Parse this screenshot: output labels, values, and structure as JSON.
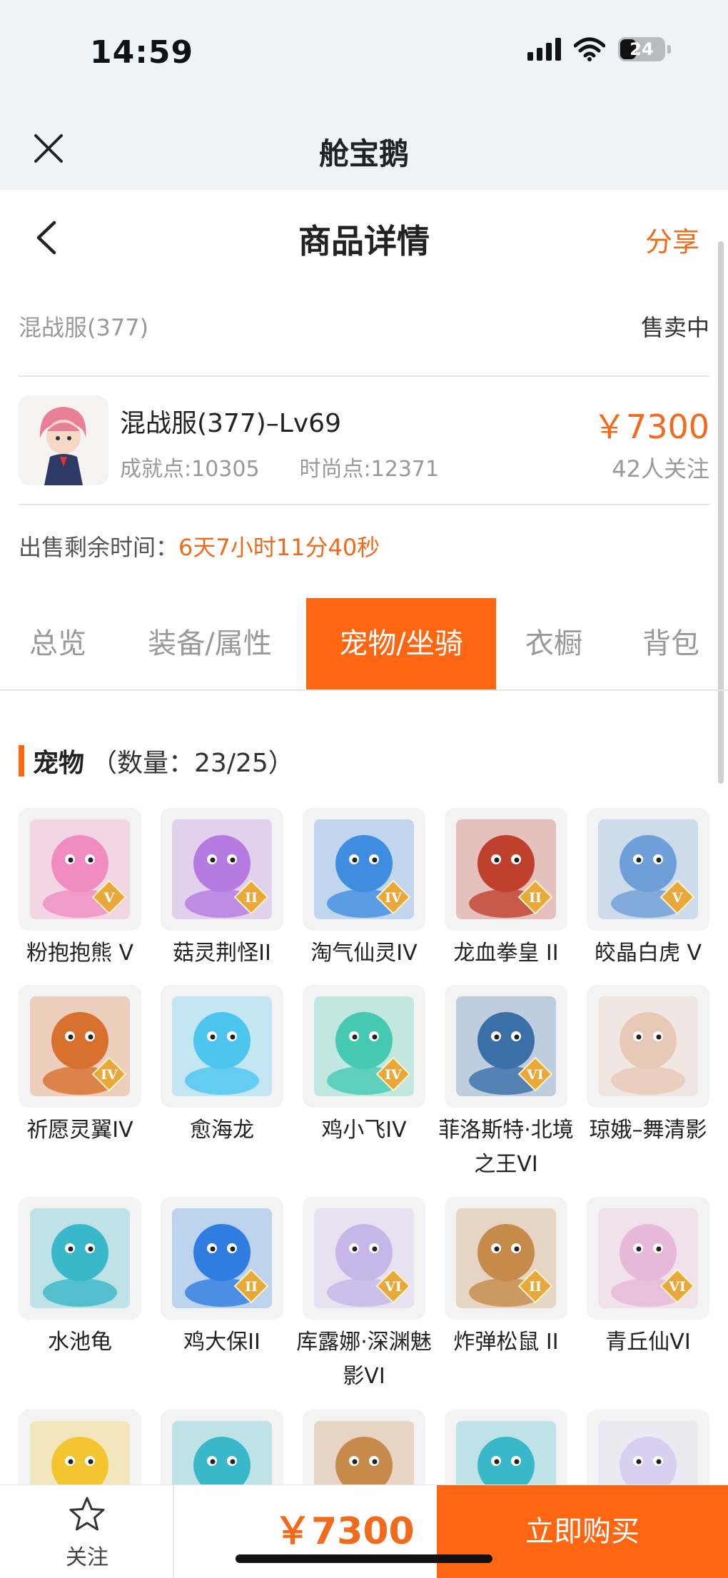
{
  "status_bar": {
    "time": "14:59",
    "battery": "24"
  },
  "host": {
    "title": "舱宝鹅"
  },
  "header": {
    "title": "商品详情",
    "share": "分享"
  },
  "listing": {
    "server": "混战服(377)",
    "status": "售卖中",
    "product_name": "混战服(377)–Lv69",
    "achievement": "成就点:10305",
    "fashion": "时尚点:12371",
    "price": "￥7300",
    "followers": "42人关注",
    "timer_label": "出售剩余时间：",
    "timer_value": "6天7小时11分40秒"
  },
  "tabs": [
    {
      "label": "总览"
    },
    {
      "label": "装备/属性"
    },
    {
      "label": "宠物/坐骑",
      "active": true
    },
    {
      "label": "衣橱"
    },
    {
      "label": "背包"
    }
  ],
  "section": {
    "title": "宠物",
    "count": "（数量：23/25）"
  },
  "pets": [
    {
      "name": "粉抱抱熊 V",
      "tier": "V",
      "color": "#f08cc0"
    },
    {
      "name": "菇灵荆怪II",
      "tier": "II",
      "color": "#b57be0"
    },
    {
      "name": "淘气仙灵IV",
      "tier": "IV",
      "color": "#3f8de0"
    },
    {
      "name": "龙血拳皇 II",
      "tier": "II",
      "color": "#c0402e"
    },
    {
      "name": "皎晶白虎 V",
      "tier": "V",
      "color": "#6f9fd8"
    },
    {
      "name": "祈愿灵翼IV",
      "tier": "IV",
      "color": "#d8702e"
    },
    {
      "name": "愈海龙",
      "tier": "",
      "color": "#4cc6ef"
    },
    {
      "name": "鸡小飞IV",
      "tier": "IV",
      "color": "#45c9b3"
    },
    {
      "name": "菲洛斯特·北境之王VI",
      "tier": "VI",
      "color": "#3a6fa8"
    },
    {
      "name": "琼娥–舞清影",
      "tier": "",
      "color": "#e8c9b8"
    },
    {
      "name": "水池龟",
      "tier": "",
      "color": "#39b8c9"
    },
    {
      "name": "鸡大保II",
      "tier": "II",
      "color": "#2f7de0"
    },
    {
      "name": "库露娜·深渊魅影VI",
      "tier": "VI",
      "color": "#c7b6e8"
    },
    {
      "name": "炸弹松鼠 II",
      "tier": "II",
      "color": "#c68a4a"
    },
    {
      "name": "青丘仙VI",
      "tier": "VI",
      "color": "#e7b8d8"
    },
    {
      "name": "",
      "tier": "",
      "color": "#f2c531"
    },
    {
      "name": "",
      "tier": "",
      "color": "#39b8c9"
    },
    {
      "name": "",
      "tier": "",
      "color": "#c68a4a"
    },
    {
      "name": "",
      "tier": "",
      "color": "#39b8c9"
    },
    {
      "name": "",
      "tier": "",
      "color": "#d8d0ef"
    }
  ],
  "bottom_bar": {
    "follow": "关注",
    "price": "￥7300",
    "buy": "立即购买"
  }
}
